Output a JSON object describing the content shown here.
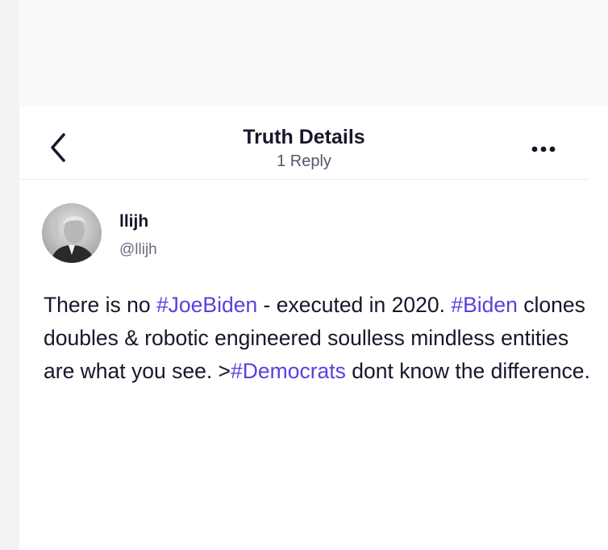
{
  "header": {
    "title": "Truth Details",
    "subtitle": "1 Reply",
    "back_icon": "chevron-left-icon",
    "more_icon": "more-horizontal-icon"
  },
  "post": {
    "author": {
      "name": "llijh",
      "handle": "@llijh"
    },
    "body": {
      "seg1": "There is no ",
      "tag1": "#JoeBiden",
      "seg2": " - executed in 2020.",
      "tag2": "#Biden",
      "seg3": " clones doubles & robotic engineered soulless mindless entities are what you see. >",
      "tag3": "#Democrats",
      "seg4": " dont know the difference."
    }
  },
  "colors": {
    "hashtag": "#5b3fe0",
    "text": "#17172a",
    "muted": "#6b6b80"
  }
}
